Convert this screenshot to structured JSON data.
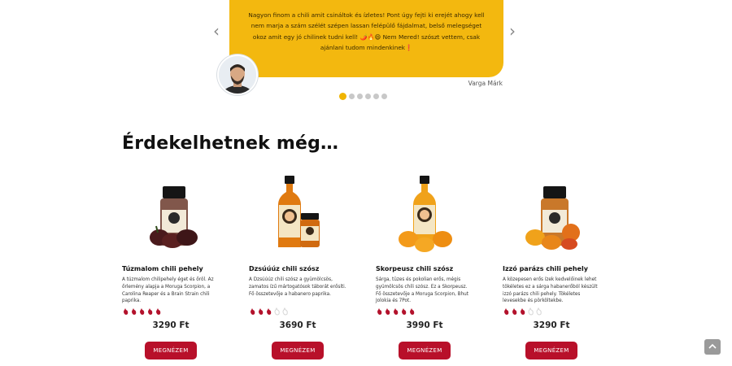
{
  "testimonial": {
    "quote": "Nagyon finom a chili amit csináltok és ízletes! Pont úgy fejti ki erejét ahogy kell nem marja a szám szélét szépen lassan felépülő fájdalmat, belső melegséget okoz amit egy jó chilinek tudni kell! 🌶️🔥😄 Nem Mered! szószt vettem, csak ajánlani tudom mindenkinek❗",
    "author": "Varga Márk",
    "prev_icon": "chevron-left-icon",
    "next_icon": "chevron-right-icon",
    "dot_count": 6,
    "active_dot": 1
  },
  "section": {
    "title": "Érdekelhetnek még…"
  },
  "products": [
    {
      "name": "Túzmalom chili pehely",
      "description": "A túzmalom chilipehely éget és őröl. Az őrlemény alapja a Moruga Scorpion, a Carolina Reaper és a Brain Strain chili paprika.",
      "rating": 5,
      "max_rating": 5,
      "price": "3290 Ft",
      "button": "MEGNÉZEM",
      "pepper_color": "#5a2020"
    },
    {
      "name": "Dzsúúúz chili szósz",
      "description": "A Dzsúúúz chili szósz a gyümölcsös, zamatos ízű mártogatósok táborát erősíti. Fő összetevője a habanero paprika.",
      "rating": 3,
      "max_rating": 5,
      "price": "3690 Ft",
      "button": "MEGNÉZEM",
      "pepper_color": "#e07a10"
    },
    {
      "name": "Skorpeusz chili szósz",
      "description": "Sárga, tüzes és pokolian erős, mégis gyümölcsös chili szósz. Ez a Skorpeusz. Fő összetevője a Moruga Scorpion, Bhut Jolokia és 7Pot.",
      "rating": 5,
      "max_rating": 5,
      "price": "3990 Ft",
      "button": "MEGNÉZEM",
      "pepper_color": "#f0a21a"
    },
    {
      "name": "Izzó parázs chili pehely",
      "description": "A közepesen erős ízek kedvelőinek lehet tökéletes ez a sárga habanerőból készült izzó parázs chili pehely. Tökéletes levesekbe és pörköltekbe.",
      "rating": 3,
      "max_rating": 5,
      "price": "3290 Ft",
      "button": "MEGNÉZEM",
      "pepper_color": "#ef8d14"
    }
  ],
  "colors": {
    "accent_yellow": "#f3b80f",
    "button_red": "#b8102a",
    "rating_red": "#b3122c",
    "rating_empty": "#d6d6d6"
  },
  "back_to_top_icon": "chevron-up-icon"
}
